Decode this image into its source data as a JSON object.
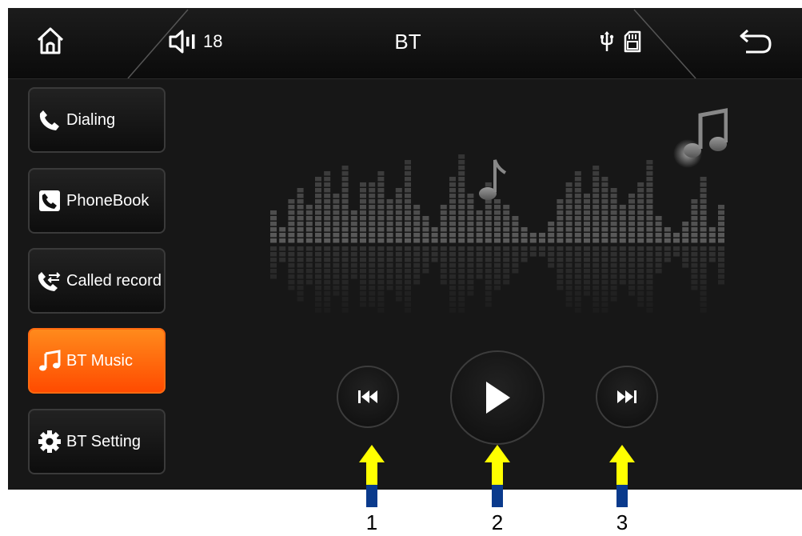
{
  "topbar": {
    "volume": "18",
    "title": "BT"
  },
  "sidebar": {
    "items": [
      {
        "label": "Dialing",
        "icon": "phone-icon"
      },
      {
        "label": "PhoneBook",
        "icon": "phonebook-icon"
      },
      {
        "label": "Called record",
        "icon": "call-record-icon"
      },
      {
        "label": "BT Music",
        "icon": "music-note-icon",
        "active": true
      },
      {
        "label": "BT Setting",
        "icon": "gear-icon"
      }
    ]
  },
  "controls": {
    "prev_icon": "previous-track-icon",
    "play_icon": "play-icon",
    "next_icon": "next-track-icon"
  },
  "annotations": [
    "1",
    "2",
    "3"
  ],
  "colors": {
    "accent": "#ff6a10",
    "arrow_yellow": "#ffff00",
    "arrow_blue": "#0a3a8c",
    "bg": "#171717"
  }
}
